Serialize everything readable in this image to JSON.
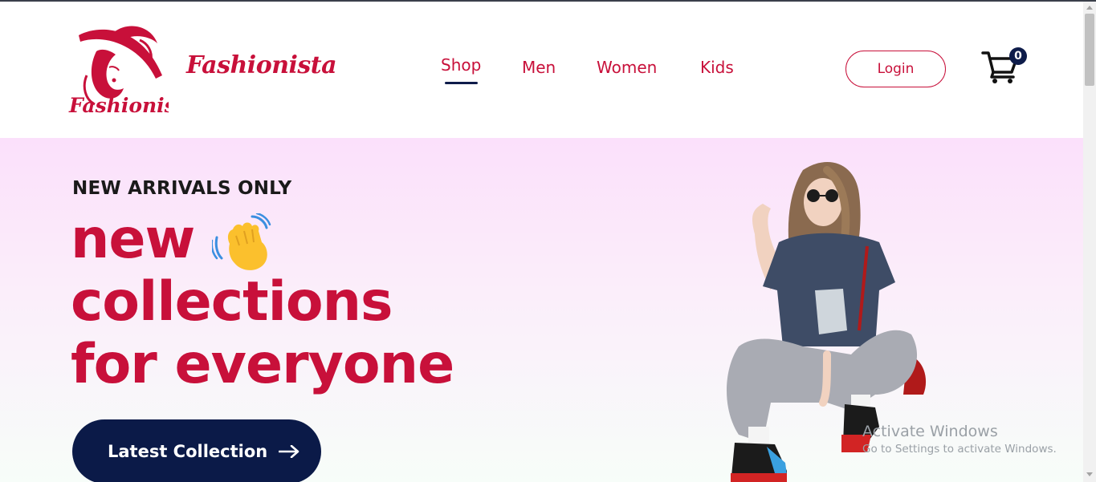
{
  "brand": {
    "name": "Fashionista",
    "logo_text": "Fashionista"
  },
  "nav": {
    "items": [
      {
        "label": "Shop",
        "active": true
      },
      {
        "label": "Men",
        "active": false
      },
      {
        "label": "Women",
        "active": false
      },
      {
        "label": "Kids",
        "active": false
      }
    ]
  },
  "header": {
    "login_label": "Login",
    "cart_count": "0",
    "cart_icon": "shopping-cart-icon"
  },
  "hero": {
    "eyebrow": "NEW ARRIVALS ONLY",
    "headline_line1": "new",
    "headline_line2": "collections",
    "headline_line3": "for everyone",
    "wave_icon": "waving-hand-icon",
    "cta_label": "Latest Collection",
    "cta_icon": "arrow-right-icon"
  },
  "os_watermark": {
    "title": "Activate Windows",
    "subtitle": "Go to Settings to activate Windows."
  },
  "colors": {
    "accent": "#c8103a",
    "navy": "#0b1a48",
    "hero_top": "#fbe0fb",
    "hero_bottom": "#f7fdf9"
  }
}
